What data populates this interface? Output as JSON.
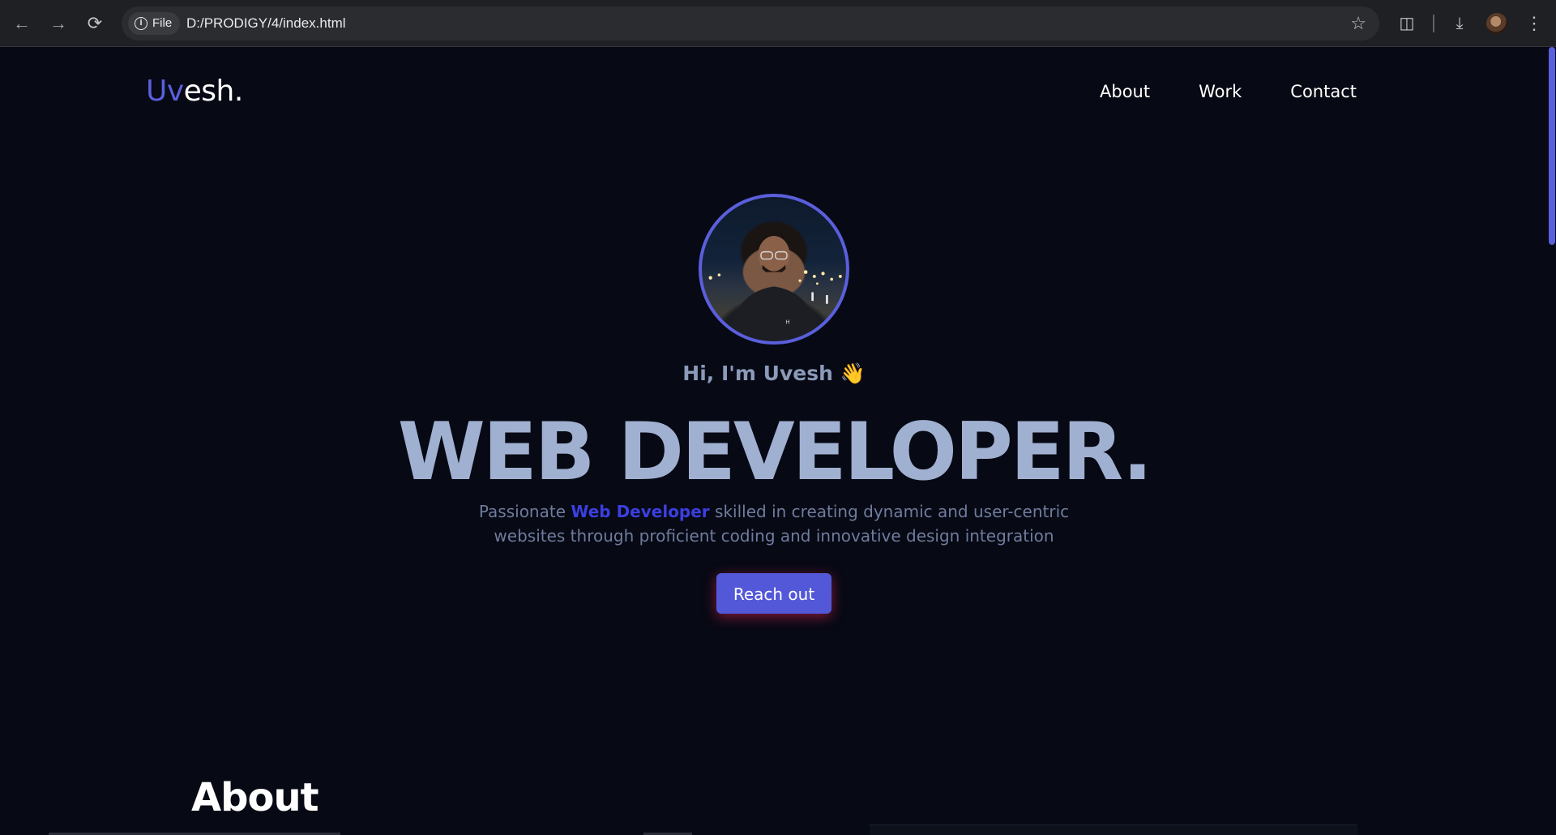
{
  "browser": {
    "back_icon": "arrow-left-icon",
    "forward_icon": "arrow-right-icon",
    "reload_icon": "reload-icon",
    "chip_label": "File",
    "url": "D:/PRODIGY/4/index.html"
  },
  "header": {
    "logo_accent": "Uv",
    "logo_rest": "esh.",
    "nav": [
      "About",
      "Work",
      "Contact"
    ]
  },
  "hero": {
    "greeting": "Hi, I'm Uvesh 👋",
    "headline": "WEB DEVELOPER.",
    "desc_pre": "Passionate ",
    "desc_highlight": "Web Developer",
    "desc_post": " skilled in creating dynamic and user-centric websites through proficient coding and innovative design integration",
    "cta": "Reach out"
  },
  "about": {
    "heading": "About"
  },
  "colors": {
    "background": "#070914",
    "accent": "#5a5fdc",
    "highlight": "#3b3fe0",
    "headline": "#a0b0d0"
  }
}
